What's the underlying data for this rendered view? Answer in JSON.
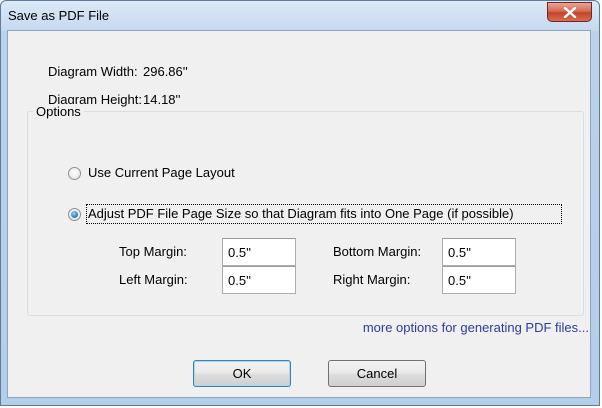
{
  "window": {
    "title": "Save as PDF File"
  },
  "diagram": {
    "width_label": "Diagram Width:",
    "width_value": "296.86''",
    "height_label": "Diagram Height:",
    "height_value": "14.18''"
  },
  "options": {
    "group_title": "Options",
    "radio_current_label": "Use Current Page Layout",
    "radio_current_checked": false,
    "radio_adjust_label": "Adjust PDF File Page Size so that Diagram fits into One Page (if possible)",
    "radio_adjust_checked": true
  },
  "margins": {
    "top_label": "Top Margin:",
    "top_value": "0.5''",
    "bottom_label": "Bottom Margin:",
    "bottom_value": "0.5''",
    "left_label": "Left Margin:",
    "left_value": "0.5''",
    "right_label": "Right Margin:",
    "right_value": "0.5''"
  },
  "link": {
    "more_options_label": "more options for generating PDF files..."
  },
  "buttons": {
    "ok_label": "OK",
    "cancel_label": "Cancel"
  },
  "colors": {
    "title_bar": "#c5d9ef",
    "close_button": "#c2452c",
    "link": "#2d3c9e",
    "dialog_background": "#f0f0f0",
    "default_button_border": "#3c7fb1"
  },
  "icons": {
    "close": "close-x-icon"
  }
}
